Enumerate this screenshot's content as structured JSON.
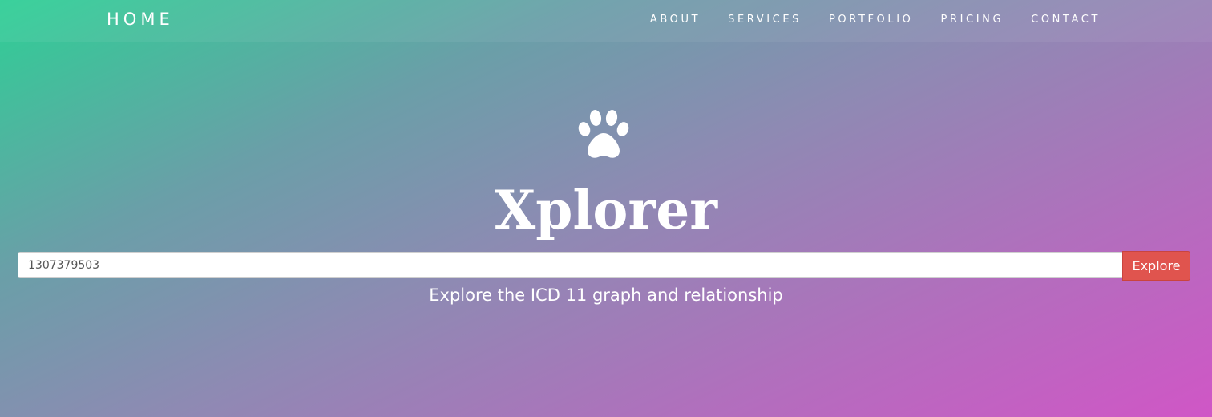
{
  "navbar": {
    "brand": "HOME",
    "links": [
      "ABOUT",
      "SERVICES",
      "PORTFOLIO",
      "PRICING",
      "CONTACT"
    ]
  },
  "hero": {
    "icon": "paw-icon",
    "title": "Xplorer",
    "subtitle": "Explore the ICD 11 graph and relationship"
  },
  "search": {
    "value": "1307379503",
    "button_label": "Explore"
  },
  "colors": {
    "gradient_start": "#2ecf95",
    "gradient_end": "#d056c6",
    "button": "#e0544e"
  }
}
